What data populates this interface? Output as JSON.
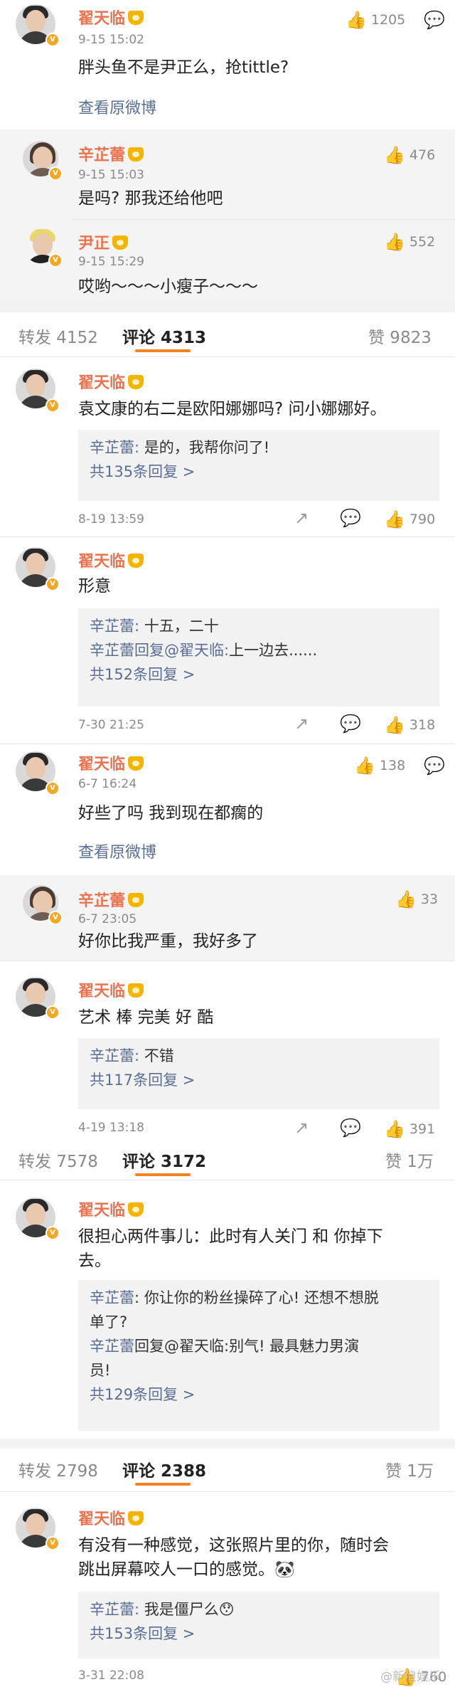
{
  "c1": {
    "name": "翟天临",
    "time": "9-15 15:02",
    "likes": "1205",
    "text": "胖头鱼不是尹正么，抢tittle?",
    "link": "查看原微博",
    "subs": [
      {
        "name": "辛芷蕾",
        "time": "9-15 15:03",
        "likes": "476",
        "text": "是吗? 那我还给他吧"
      },
      {
        "name": "尹正",
        "time": "9-15 15:29",
        "likes": "552",
        "text": "哎哟～～～小瘦子～～～"
      }
    ]
  },
  "tabs1": {
    "repost": "转发 4152",
    "comment": "评论 4313",
    "like": "赞 9823"
  },
  "c2": {
    "name": "翟天临",
    "text": "袁文康的右二是欧阳娜娜吗? 问小娜娜好。",
    "replies": [
      {
        "name": "辛芷蕾",
        "sep": ": ",
        "text": "是的，我帮你问了!"
      }
    ],
    "more": "共135条回复 >",
    "time": "8-19 13:59",
    "likes": "790"
  },
  "c3": {
    "name": "翟天临",
    "text": "形意",
    "replies": [
      {
        "name": "辛芷蕾",
        "sep": ": ",
        "text": "十五，二十"
      },
      {
        "name": "辛芷蕾",
        "sep": "回复@翟天临:",
        "text": "上一边去......"
      }
    ],
    "more": "共152条回复 >",
    "time": "7-30 21:25",
    "likes": "318"
  },
  "c4": {
    "name": "翟天临",
    "time": "6-7 16:24",
    "likes": "138",
    "text": "好些了吗 我到现在都瘸的",
    "link": "查看原微博",
    "sub": {
      "name": "辛芷蕾",
      "time": "6-7 23:05",
      "likes": "33",
      "text": "好你比我严重，我好多了"
    }
  },
  "c5": {
    "name": "翟天临",
    "text": "艺术 棒 完美 好 酷",
    "replies": [
      {
        "name": "辛芷蕾",
        "sep": ": ",
        "text": "不错"
      }
    ],
    "more": "共117条回复 >",
    "time": "4-19 13:18",
    "likes": "391"
  },
  "tabs2": {
    "repost": "转发 7578",
    "comment": "评论 3172",
    "like": "赞 1万"
  },
  "c6": {
    "name": "翟天临",
    "text1": "很担心两件事儿：此时有人关门 和 你掉下",
    "text2": "去。",
    "r1a": "辛芷蕾",
    "r1b": ": 你让你的粉丝操碎了心! 还想不想脱",
    "r1c": "单了?",
    "r2a": "辛芷蕾",
    "r2b": "回复@翟天临:别气! 最具魅力男演",
    "r2c": "员!",
    "more": "共129条回复 >"
  },
  "tabs3": {
    "repost": "转发 2798",
    "comment": "评论 2388",
    "like": "赞 1万"
  },
  "c7": {
    "name": "翟天临",
    "text1": "有没有一种感觉，这张照片里的你，随时会",
    "text2": "跳出屏幕咬人一口的感觉。🐼",
    "replies": [
      {
        "name": "辛芷蕾",
        "sep": ": ",
        "text": "我是僵尸么😯"
      }
    ],
    "more": "共153条回复 >",
    "time": "3-31 22:08",
    "likes": "760"
  },
  "watermark": "@新浪娱乐"
}
